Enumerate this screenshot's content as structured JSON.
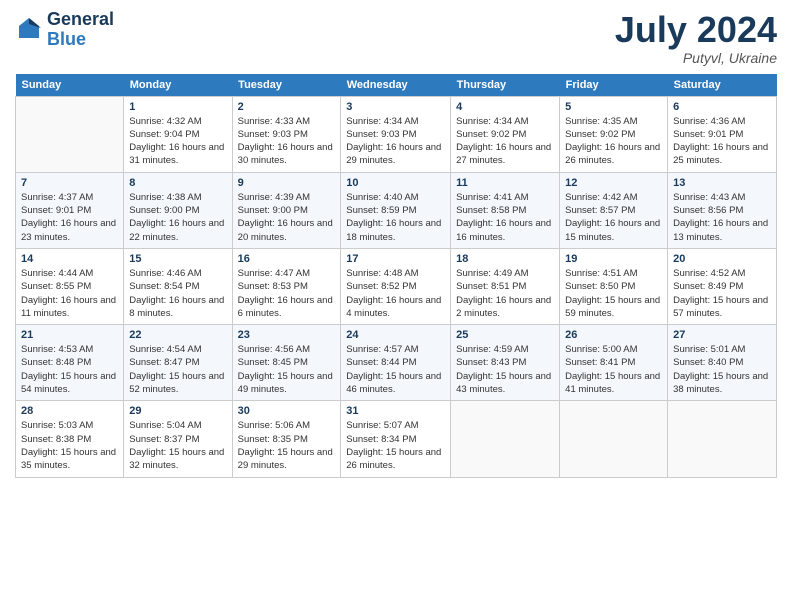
{
  "header": {
    "logo_line1": "General",
    "logo_line2": "Blue",
    "month_year": "July 2024",
    "location": "Putyvl, Ukraine"
  },
  "days_of_week": [
    "Sunday",
    "Monday",
    "Tuesday",
    "Wednesday",
    "Thursday",
    "Friday",
    "Saturday"
  ],
  "weeks": [
    [
      {
        "day": "",
        "sunrise": "",
        "sunset": "",
        "daylight": ""
      },
      {
        "day": "1",
        "sunrise": "Sunrise: 4:32 AM",
        "sunset": "Sunset: 9:04 PM",
        "daylight": "Daylight: 16 hours and 31 minutes."
      },
      {
        "day": "2",
        "sunrise": "Sunrise: 4:33 AM",
        "sunset": "Sunset: 9:03 PM",
        "daylight": "Daylight: 16 hours and 30 minutes."
      },
      {
        "day": "3",
        "sunrise": "Sunrise: 4:34 AM",
        "sunset": "Sunset: 9:03 PM",
        "daylight": "Daylight: 16 hours and 29 minutes."
      },
      {
        "day": "4",
        "sunrise": "Sunrise: 4:34 AM",
        "sunset": "Sunset: 9:02 PM",
        "daylight": "Daylight: 16 hours and 27 minutes."
      },
      {
        "day": "5",
        "sunrise": "Sunrise: 4:35 AM",
        "sunset": "Sunset: 9:02 PM",
        "daylight": "Daylight: 16 hours and 26 minutes."
      },
      {
        "day": "6",
        "sunrise": "Sunrise: 4:36 AM",
        "sunset": "Sunset: 9:01 PM",
        "daylight": "Daylight: 16 hours and 25 minutes."
      }
    ],
    [
      {
        "day": "7",
        "sunrise": "Sunrise: 4:37 AM",
        "sunset": "Sunset: 9:01 PM",
        "daylight": "Daylight: 16 hours and 23 minutes."
      },
      {
        "day": "8",
        "sunrise": "Sunrise: 4:38 AM",
        "sunset": "Sunset: 9:00 PM",
        "daylight": "Daylight: 16 hours and 22 minutes."
      },
      {
        "day": "9",
        "sunrise": "Sunrise: 4:39 AM",
        "sunset": "Sunset: 9:00 PM",
        "daylight": "Daylight: 16 hours and 20 minutes."
      },
      {
        "day": "10",
        "sunrise": "Sunrise: 4:40 AM",
        "sunset": "Sunset: 8:59 PM",
        "daylight": "Daylight: 16 hours and 18 minutes."
      },
      {
        "day": "11",
        "sunrise": "Sunrise: 4:41 AM",
        "sunset": "Sunset: 8:58 PM",
        "daylight": "Daylight: 16 hours and 16 minutes."
      },
      {
        "day": "12",
        "sunrise": "Sunrise: 4:42 AM",
        "sunset": "Sunset: 8:57 PM",
        "daylight": "Daylight: 16 hours and 15 minutes."
      },
      {
        "day": "13",
        "sunrise": "Sunrise: 4:43 AM",
        "sunset": "Sunset: 8:56 PM",
        "daylight": "Daylight: 16 hours and 13 minutes."
      }
    ],
    [
      {
        "day": "14",
        "sunrise": "Sunrise: 4:44 AM",
        "sunset": "Sunset: 8:55 PM",
        "daylight": "Daylight: 16 hours and 11 minutes."
      },
      {
        "day": "15",
        "sunrise": "Sunrise: 4:46 AM",
        "sunset": "Sunset: 8:54 PM",
        "daylight": "Daylight: 16 hours and 8 minutes."
      },
      {
        "day": "16",
        "sunrise": "Sunrise: 4:47 AM",
        "sunset": "Sunset: 8:53 PM",
        "daylight": "Daylight: 16 hours and 6 minutes."
      },
      {
        "day": "17",
        "sunrise": "Sunrise: 4:48 AM",
        "sunset": "Sunset: 8:52 PM",
        "daylight": "Daylight: 16 hours and 4 minutes."
      },
      {
        "day": "18",
        "sunrise": "Sunrise: 4:49 AM",
        "sunset": "Sunset: 8:51 PM",
        "daylight": "Daylight: 16 hours and 2 minutes."
      },
      {
        "day": "19",
        "sunrise": "Sunrise: 4:51 AM",
        "sunset": "Sunset: 8:50 PM",
        "daylight": "Daylight: 15 hours and 59 minutes."
      },
      {
        "day": "20",
        "sunrise": "Sunrise: 4:52 AM",
        "sunset": "Sunset: 8:49 PM",
        "daylight": "Daylight: 15 hours and 57 minutes."
      }
    ],
    [
      {
        "day": "21",
        "sunrise": "Sunrise: 4:53 AM",
        "sunset": "Sunset: 8:48 PM",
        "daylight": "Daylight: 15 hours and 54 minutes."
      },
      {
        "day": "22",
        "sunrise": "Sunrise: 4:54 AM",
        "sunset": "Sunset: 8:47 PM",
        "daylight": "Daylight: 15 hours and 52 minutes."
      },
      {
        "day": "23",
        "sunrise": "Sunrise: 4:56 AM",
        "sunset": "Sunset: 8:45 PM",
        "daylight": "Daylight: 15 hours and 49 minutes."
      },
      {
        "day": "24",
        "sunrise": "Sunrise: 4:57 AM",
        "sunset": "Sunset: 8:44 PM",
        "daylight": "Daylight: 15 hours and 46 minutes."
      },
      {
        "day": "25",
        "sunrise": "Sunrise: 4:59 AM",
        "sunset": "Sunset: 8:43 PM",
        "daylight": "Daylight: 15 hours and 43 minutes."
      },
      {
        "day": "26",
        "sunrise": "Sunrise: 5:00 AM",
        "sunset": "Sunset: 8:41 PM",
        "daylight": "Daylight: 15 hours and 41 minutes."
      },
      {
        "day": "27",
        "sunrise": "Sunrise: 5:01 AM",
        "sunset": "Sunset: 8:40 PM",
        "daylight": "Daylight: 15 hours and 38 minutes."
      }
    ],
    [
      {
        "day": "28",
        "sunrise": "Sunrise: 5:03 AM",
        "sunset": "Sunset: 8:38 PM",
        "daylight": "Daylight: 15 hours and 35 minutes."
      },
      {
        "day": "29",
        "sunrise": "Sunrise: 5:04 AM",
        "sunset": "Sunset: 8:37 PM",
        "daylight": "Daylight: 15 hours and 32 minutes."
      },
      {
        "day": "30",
        "sunrise": "Sunrise: 5:06 AM",
        "sunset": "Sunset: 8:35 PM",
        "daylight": "Daylight: 15 hours and 29 minutes."
      },
      {
        "day": "31",
        "sunrise": "Sunrise: 5:07 AM",
        "sunset": "Sunset: 8:34 PM",
        "daylight": "Daylight: 15 hours and 26 minutes."
      },
      {
        "day": "",
        "sunrise": "",
        "sunset": "",
        "daylight": ""
      },
      {
        "day": "",
        "sunrise": "",
        "sunset": "",
        "daylight": ""
      },
      {
        "day": "",
        "sunrise": "",
        "sunset": "",
        "daylight": ""
      }
    ]
  ]
}
